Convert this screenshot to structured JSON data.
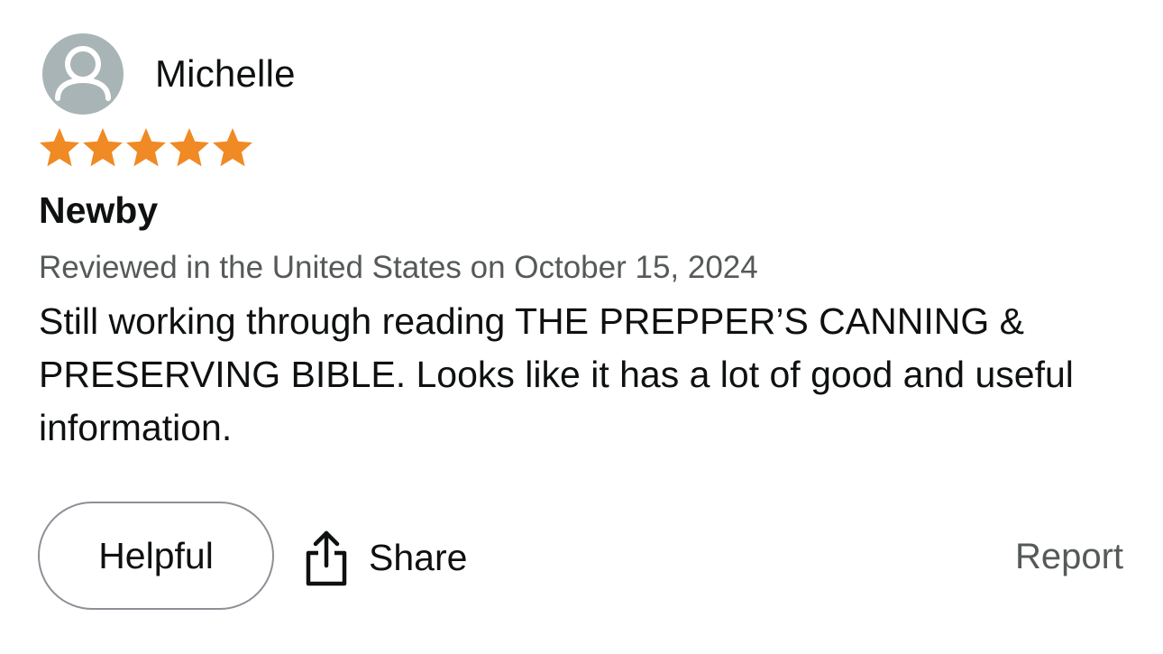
{
  "reviewer": {
    "name": "Michelle",
    "avatar_icon": "user-silhouette-icon",
    "avatar_color": "#a9b4b6"
  },
  "rating": {
    "value": 5,
    "max": 5,
    "star_color": "#f08a24"
  },
  "review": {
    "title": "Newby",
    "meta": "Reviewed in the United States on October 15, 2024",
    "body": "Still working through reading THE PREPPER’S CANNING & PRESERVING BIBLE. Looks like it has a lot of good and useful information."
  },
  "actions": {
    "helpful_label": "Helpful",
    "share_label": "Share",
    "share_icon": "share-icon",
    "report_label": "Report"
  }
}
